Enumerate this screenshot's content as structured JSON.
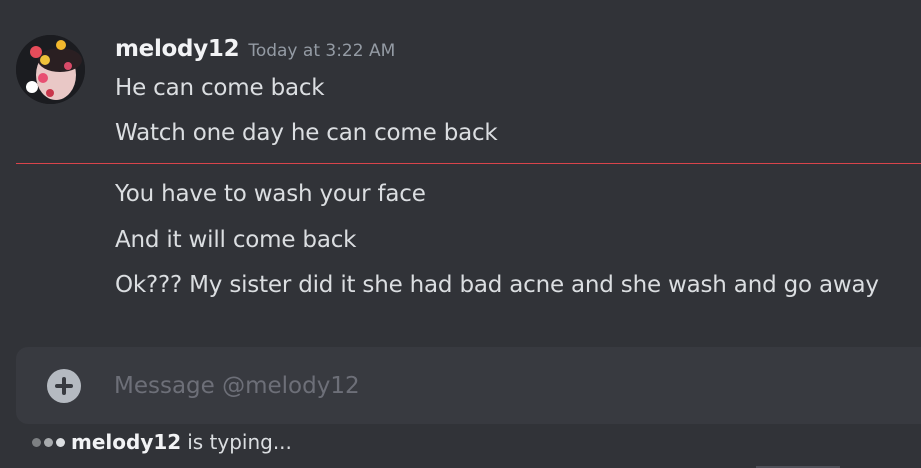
{
  "message_group": {
    "author": "melody12",
    "timestamp": "Today at 3:22 AM",
    "messages": [
      "He can come back",
      "Watch one day he can come back"
    ],
    "new_messages": [
      "You have to wash your face",
      "And it will come back",
      "Ok??? My sister did it she had bad acne and she wash and go away"
    ]
  },
  "composer": {
    "placeholder": "Message @melody12",
    "add_icon": "plus-circle-icon"
  },
  "typing_indicator": {
    "user": "melody12",
    "text": "is typing..."
  },
  "colors": {
    "background": "#313338",
    "composer": "#383a40",
    "new_messages_divider": "#d9444b",
    "username": "#f2f3f5",
    "timestamp": "#949ba4",
    "message_text": "#dbdee1"
  }
}
